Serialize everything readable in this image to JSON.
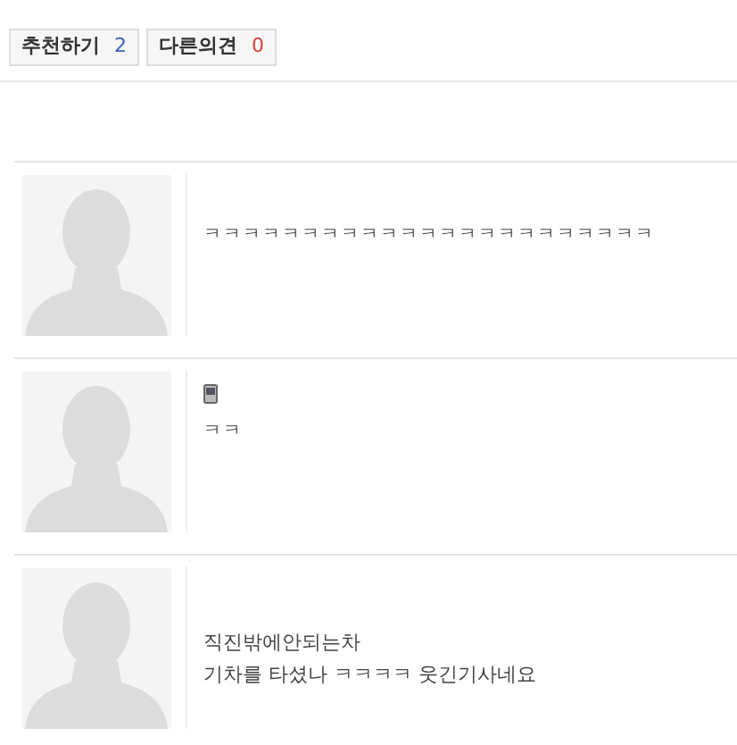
{
  "vote_buttons": [
    {
      "label": "추천하기",
      "count": "2",
      "kind": "up"
    },
    {
      "label": "다른의견",
      "count": "0",
      "kind": "down"
    }
  ],
  "comments": [
    {
      "lines": [
        "ㅋㅋㅋㅋㅋㅋㅋㅋㅋㅋㅋㅋㅋㅋㅋㅋㅋㅋㅋㅋㅋㅋㅋ"
      ],
      "mobile": false
    },
    {
      "lines": [
        "ㅋㅋ"
      ],
      "mobile": true
    },
    {
      "lines": [
        "직진밖에안되는차",
        "기차를 타셨나 ㅋㅋㅋㅋ 웃긴기사네요"
      ],
      "mobile": false
    }
  ]
}
